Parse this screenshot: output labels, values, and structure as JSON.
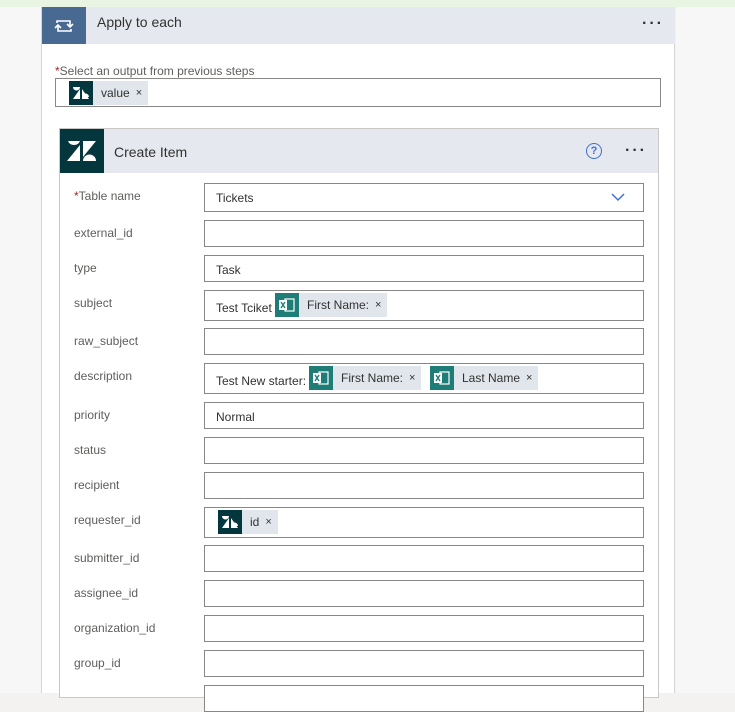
{
  "apply_to_each": {
    "title": "Apply to each",
    "more_label": "···",
    "select_label": "Select an output from previous steps",
    "required_mark": "*",
    "token": {
      "label": "value",
      "close": "×",
      "icon": "zendesk-icon"
    }
  },
  "create_item": {
    "title": "Create Item",
    "help_label": "?",
    "more_label": "···",
    "fields": [
      {
        "label": "Table name",
        "required": "*",
        "value": "Tickets",
        "type": "dropdown"
      },
      {
        "label": "external_id",
        "value": ""
      },
      {
        "label": "type",
        "value": "Task"
      },
      {
        "label": "subject",
        "value": "Test Tciket",
        "tokens": [
          {
            "label": "First Name:",
            "close": "×",
            "icon": "excel-icon"
          }
        ]
      },
      {
        "label": "raw_subject",
        "value": ""
      },
      {
        "label": "description",
        "value": "Test New starter:",
        "tokens": [
          {
            "label": "First Name:",
            "close": "×",
            "icon": "excel-icon"
          },
          {
            "label": "Last Name",
            "close": "×",
            "icon": "excel-icon"
          }
        ]
      },
      {
        "label": "priority",
        "value": "Normal"
      },
      {
        "label": "status",
        "value": ""
      },
      {
        "label": "recipient",
        "value": ""
      },
      {
        "label": "requester_id",
        "value": "",
        "tokens": [
          {
            "label": "id",
            "close": "×",
            "icon": "zendesk-icon"
          }
        ]
      },
      {
        "label": "submitter_id",
        "value": ""
      },
      {
        "label": "assignee_id",
        "value": ""
      },
      {
        "label": "organization_id",
        "value": ""
      },
      {
        "label": "group_id",
        "value": ""
      }
    ]
  },
  "colors": {
    "apply_icon_bg": "#486991",
    "zendesk_bg": "#03363d",
    "excel_bg": "#1f7d78",
    "help_blue": "#3f6ed8",
    "required_red": "#a4262c"
  }
}
